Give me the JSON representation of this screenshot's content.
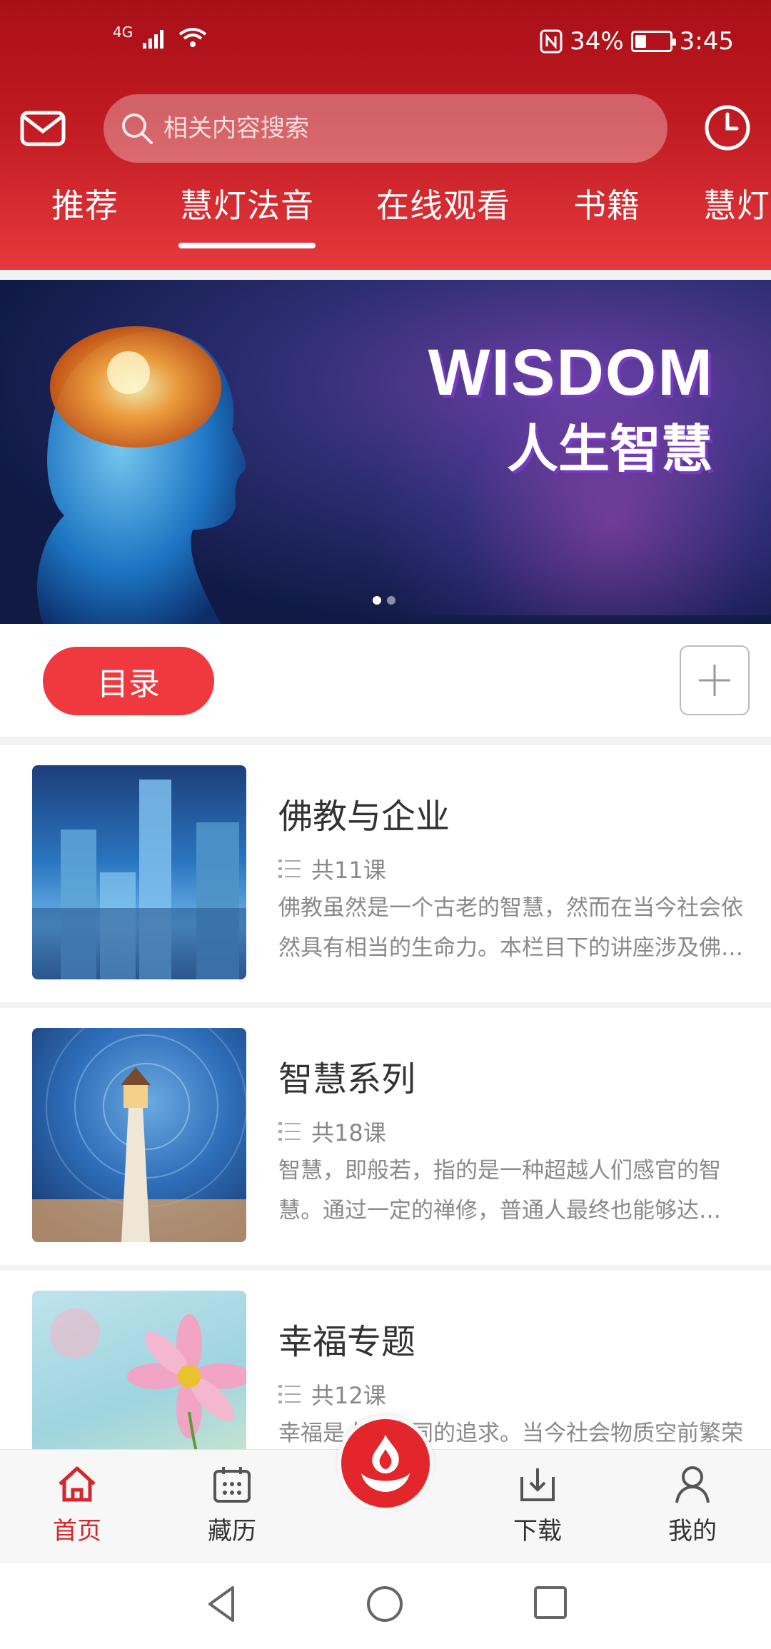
{
  "status_bar": {
    "network": "4G",
    "battery_percent": "34%",
    "battery_level": 0.34,
    "time": "3:45"
  },
  "header": {
    "search_placeholder": "相关内容搜索",
    "icons": [
      "mail-icon",
      "search-icon",
      "clock-icon"
    ],
    "tabs": [
      {
        "label": "推荐"
      },
      {
        "label": "慧灯法音",
        "active": true
      },
      {
        "label": "在线观看"
      },
      {
        "label": "书籍"
      },
      {
        "label": "慧灯"
      }
    ]
  },
  "banner": {
    "title": "WISDOM",
    "subtitle": "人生智慧",
    "slide_count": 2,
    "active_slide": 1
  },
  "catalog": {
    "button_label": "目录",
    "add_icon": "plus-icon"
  },
  "courses": [
    {
      "title": "佛教与企业",
      "lessons": "共11课",
      "description": "佛教虽然是一个古老的智慧，然而在当今社会依然具有相当的生命力。本栏目下的讲座涉及佛教与企业的关系……"
    },
    {
      "title": "智慧系列",
      "lessons": "共18课",
      "description": "智慧，即般若，指的是一种超越人们感官的智慧。通过一定的禅修，普通人最终也能够达到……"
    },
    {
      "title": "幸福专题",
      "lessons": "共12课",
      "description": "幸福是人类共同的追求。当今社会物质空前繁荣"
    }
  ],
  "bottom_nav": {
    "items": [
      {
        "label": "首页",
        "icon": "home-icon",
        "active": true
      },
      {
        "label": "藏历",
        "icon": "calendar-icon"
      },
      {
        "label": "",
        "icon": "flame-logo-icon"
      },
      {
        "label": "下载",
        "icon": "download-icon"
      },
      {
        "label": "我的",
        "icon": "profile-icon"
      }
    ]
  },
  "colors": {
    "brand_red": "#d5262c",
    "button_red": "#f0393f"
  }
}
